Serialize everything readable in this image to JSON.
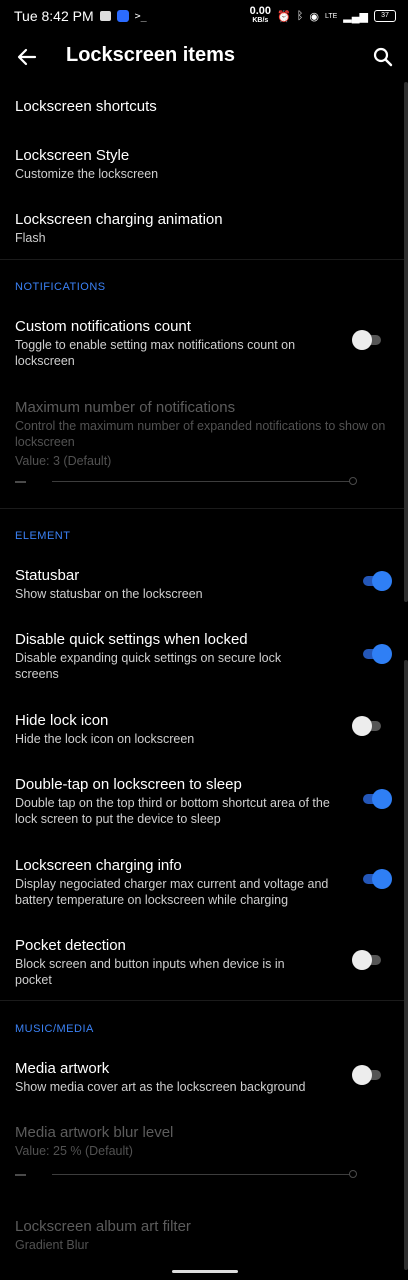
{
  "status_bar": {
    "time": "Tue 8:42 PM",
    "net_speed_value": "0.00",
    "net_speed_unit": "KB/s",
    "network": "LTE",
    "battery_level": "37"
  },
  "app_bar": {
    "title": "Lockscreen items",
    "back_icon": "arrow-left-icon",
    "search_icon": "search-icon"
  },
  "items_top": [
    {
      "title": "Lockscreen shortcuts"
    },
    {
      "title": "Lockscreen Style",
      "subtitle": "Customize the lockscreen"
    },
    {
      "title": "Lockscreen charging animation",
      "subtitle": "Flash"
    }
  ],
  "notifications": {
    "header": "NOTIFICATIONS",
    "custom_count": {
      "title": "Custom notifications count",
      "subtitle": "Toggle to enable setting max notifications count on lockscreen",
      "enabled": false
    },
    "max_notifications": {
      "title": "Maximum number of notifications",
      "subtitle": "Control the maximum number of expanded notifications to show on lockscreen",
      "value_text": "Value: 3  (Default)",
      "value": 3,
      "disabled": true
    }
  },
  "element": {
    "header": "ELEMENT",
    "items": [
      {
        "title": "Statusbar",
        "subtitle": "Show statusbar on the lockscreen",
        "enabled": true
      },
      {
        "title": "Disable quick settings when locked",
        "subtitle": "Disable expanding quick settings on secure lock screens",
        "enabled": true
      },
      {
        "title": "Hide lock icon",
        "subtitle": "Hide the lock icon on lockscreen",
        "enabled": false
      },
      {
        "title": "Double-tap on lockscreen to sleep",
        "subtitle": "Double tap on the top third or bottom shortcut area of the lock screen to put the device to sleep",
        "enabled": true
      },
      {
        "title": "Lockscreen charging info",
        "subtitle": "Display negociated charger max current and voltage and battery temperature on lockscreen while charging",
        "enabled": true
      },
      {
        "title": "Pocket detection",
        "subtitle": "Block screen and button inputs when device is in pocket",
        "enabled": false
      }
    ]
  },
  "music_media": {
    "header": "MUSIC/MEDIA",
    "media_artwork": {
      "title": "Media artwork",
      "subtitle": "Show media cover art as the lockscreen background",
      "enabled": false
    },
    "blur_level": {
      "title": "Media artwork blur level",
      "value_text": "Value: 25 % (Default)",
      "value": 25,
      "disabled": true
    },
    "album_art_filter": {
      "title": "Lockscreen album art filter",
      "subtitle": "Gradient Blur",
      "disabled": true
    }
  },
  "colors": {
    "accent": "#3b82f6",
    "toggle_on": "#2f7ff5",
    "background": "#000000"
  }
}
